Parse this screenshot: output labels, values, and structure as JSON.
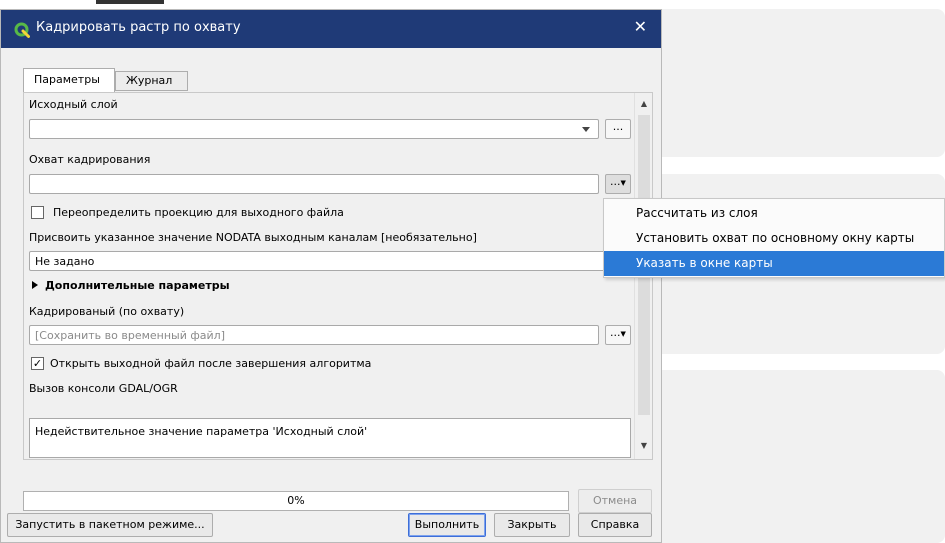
{
  "window": {
    "title": "Кадрировать растр по охвату",
    "close_symbol": "✕"
  },
  "tabs": [
    {
      "label": "Параметры",
      "active": true
    },
    {
      "label": "Журнал",
      "active": false
    }
  ],
  "params": {
    "input_layer_label": "Исходный слой",
    "input_layer_value": "",
    "extent_label": "Охват кадрирования",
    "extent_value": "",
    "override_projection_label": "Переопределить проекцию для выходного файла",
    "override_projection_checked": false,
    "nodata_label": "Присвоить указанное значение NODATA выходным каналам [необязательно]",
    "nodata_value": "Не задано",
    "advanced_label": "Дополнительные параметры",
    "output_label": "Кадрированый (по охвату)",
    "output_placeholder": "[Сохранить во временный файл]",
    "open_output_label": "Открыть выходной файл после завершения алгоритма",
    "open_output_checked": true,
    "console_label": "Вызов консоли GDAL/OGR",
    "console_text": "Недействительное значение параметра 'Исходный слой'",
    "dots": "..."
  },
  "progress": {
    "value": 0,
    "text": "0%"
  },
  "buttons": {
    "cancel": "Отмена",
    "batch": "Запустить в пакетном режиме...",
    "run": "Выполнить",
    "close": "Закрыть",
    "help": "Справка"
  },
  "context_menu": {
    "items": [
      {
        "label": "Рассчитать из слоя",
        "highlighted": false
      },
      {
        "label": "Установить охват по основному окну карты",
        "highlighted": false
      },
      {
        "label": "Указать в окне карты",
        "highlighted": true
      }
    ]
  },
  "colors": {
    "titlebar": "#1f3a77",
    "menu_highlight": "#2b7ad6",
    "qgis_logo": "#58b947"
  }
}
